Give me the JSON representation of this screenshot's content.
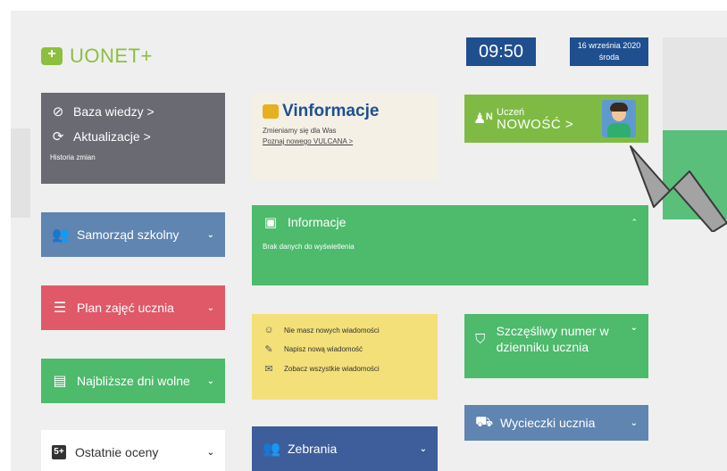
{
  "header": {
    "logo_text": "UONET+"
  },
  "clock": {
    "time": "09:50",
    "date": "16 września 2020",
    "weekday": "środa"
  },
  "baza": {
    "baza_label": "Baza wiedzy >",
    "aktualizacje_label": "Aktualizacje >",
    "historia_label": "Historia zmian"
  },
  "vinformacje": {
    "title": "Vinformacje",
    "subtitle": "Zmieniamy się dla Was",
    "link": "Poznaj nowego VULCANA >"
  },
  "uczen": {
    "title": "Uczeń",
    "subtitle": "NOWOŚĆ >"
  },
  "tiles": {
    "samorzad": "Samorząd szkolny",
    "plan": "Plan zajęć ucznia",
    "dni_wolne": "Najbliższe dni wolne",
    "oceny": "Ostatnie oceny",
    "zebrania": "Zebrania",
    "wycieczki": "Wycieczki ucznia",
    "numer": "Szczęśliwy numer w dzienniku ucznia"
  },
  "informacje": {
    "title": "Informacje",
    "empty": "Brak danych do wyświetlenia"
  },
  "messages": {
    "no_new": "Nie masz nowych wiadomości",
    "write": "Napisz nową wiadomość",
    "see_all": "Zobacz wszystkie wiadomości"
  },
  "icons": {
    "oceny_badge": "5+"
  },
  "colors": {
    "brand": "#8dbf3e",
    "navy": "#1f4f8f",
    "green": "#4dba6c",
    "blue": "#5f85b0",
    "red": "#df5968",
    "yellow": "#f3e079"
  }
}
